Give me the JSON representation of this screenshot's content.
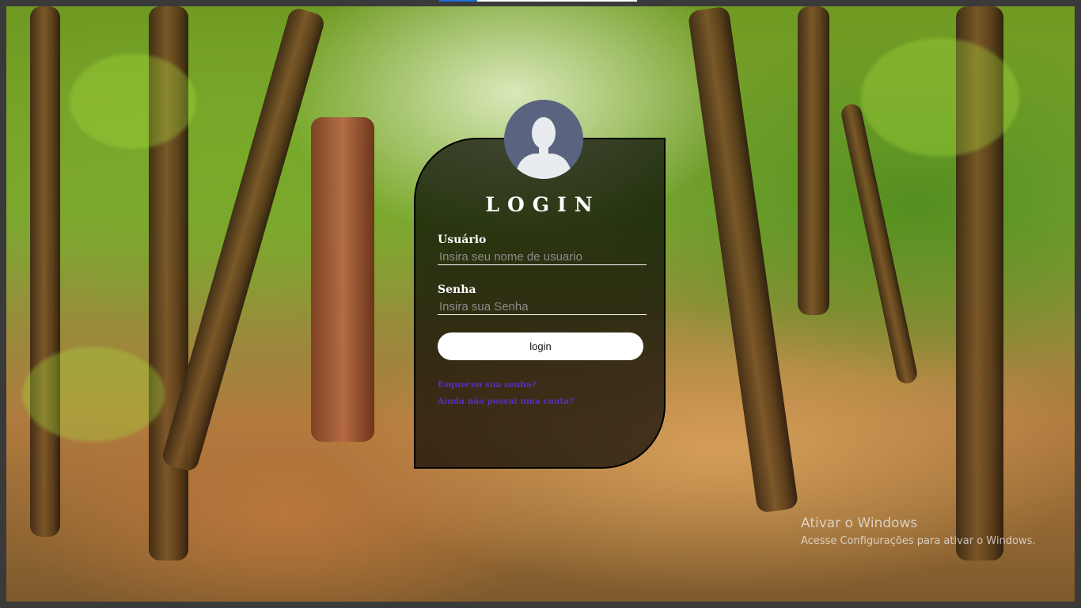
{
  "login": {
    "title": "LOGIN",
    "username_label": "Usuário",
    "username_placeholder": "Insira seu nome de usuario",
    "password_label": "Senha",
    "password_placeholder": "Insira sua Senha",
    "button_label": "login",
    "forgot_link": "Esqueceu sua senha?",
    "signup_link": "Ainda não possui uma conta?"
  },
  "watermark": {
    "title": "Ativar o Windows",
    "subtitle": "Acesse Configurações para ativar o Windows."
  },
  "colors": {
    "card_background": "#000000",
    "avatar_background": "#5a6480",
    "link": "#5a2ec4",
    "button": "#ffffff"
  },
  "icons": {
    "avatar": "user-silhouette-icon"
  }
}
